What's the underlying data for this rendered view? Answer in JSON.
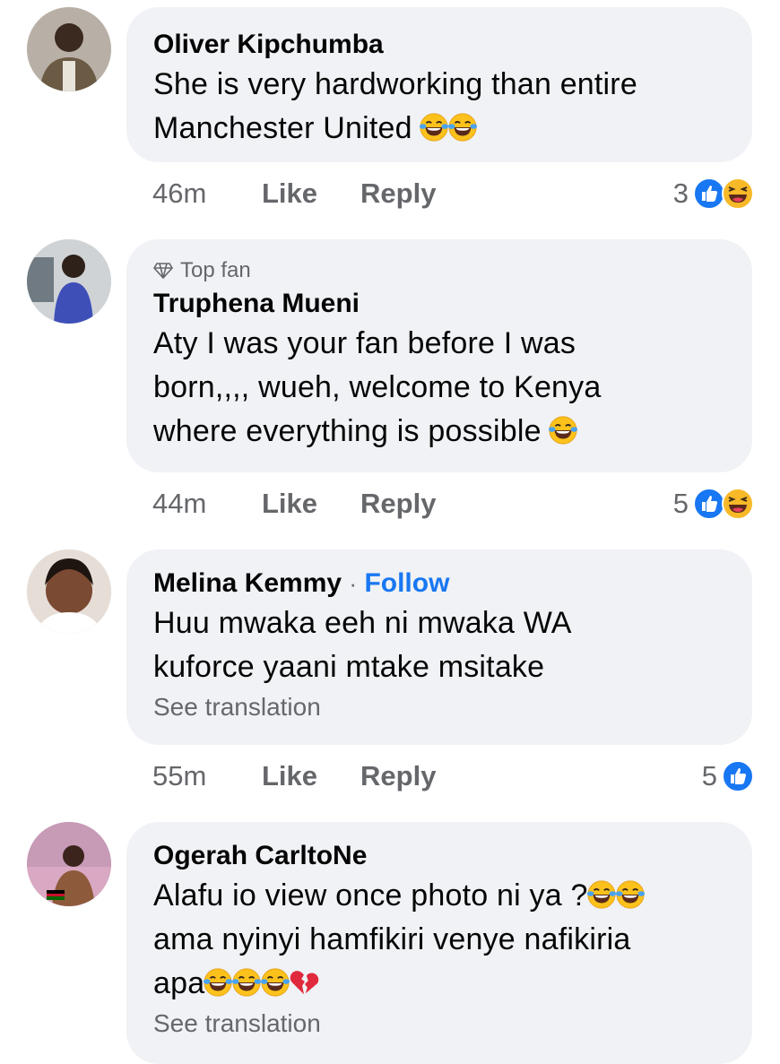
{
  "comments": [
    {
      "author": "Oliver Kipchumba",
      "lines": [
        "She is very hardworking than entire",
        "Manchester United"
      ],
      "line_emojis": [
        [],
        [
          "laughing-tears",
          "laughing-tears"
        ]
      ],
      "time": "46m",
      "like": "Like",
      "reply": "Reply",
      "reaction_count": "3",
      "reactions": [
        "like",
        "haha"
      ]
    },
    {
      "badge": "Top fan",
      "author": "Truphena Mueni",
      "lines": [
        "Aty I was your fan before I was",
        "born,,,, wueh, welcome to Kenya",
        "where everything is possible"
      ],
      "line_emojis": [
        [],
        [],
        [
          "laughing-tears"
        ]
      ],
      "time": "44m",
      "like": "Like",
      "reply": "Reply",
      "reaction_count": "5",
      "reactions": [
        "like",
        "haha"
      ]
    },
    {
      "author": "Melina Kemmy",
      "follow_separator": "·",
      "follow": "Follow",
      "lines": [
        "Huu mwaka eeh ni mwaka WA",
        "kuforce yaani mtake msitake"
      ],
      "line_emojis": [
        [],
        []
      ],
      "see_translation": "See translation",
      "time": "55m",
      "like": "Like",
      "reply": "Reply",
      "reaction_count": "5",
      "reactions": [
        "like"
      ]
    },
    {
      "author": "Ogerah CarltoNe",
      "lines": [
        "Alafu io view once photo ni ya ?",
        "ama nyinyi hamfikiri venye nafikiria",
        "apa"
      ],
      "line_emojis": [
        [
          "laughing-tears",
          "laughing-tears"
        ],
        [],
        [
          "laughing-tears",
          "laughing-tears",
          "laughing-tears",
          "broken-heart"
        ]
      ],
      "see_translation": "See translation"
    }
  ],
  "colors": {
    "bubble": "#f0f2f5",
    "link_blue": "#1877f2",
    "meta_gray": "#65676b",
    "haha_yellow": "#f7b928"
  }
}
